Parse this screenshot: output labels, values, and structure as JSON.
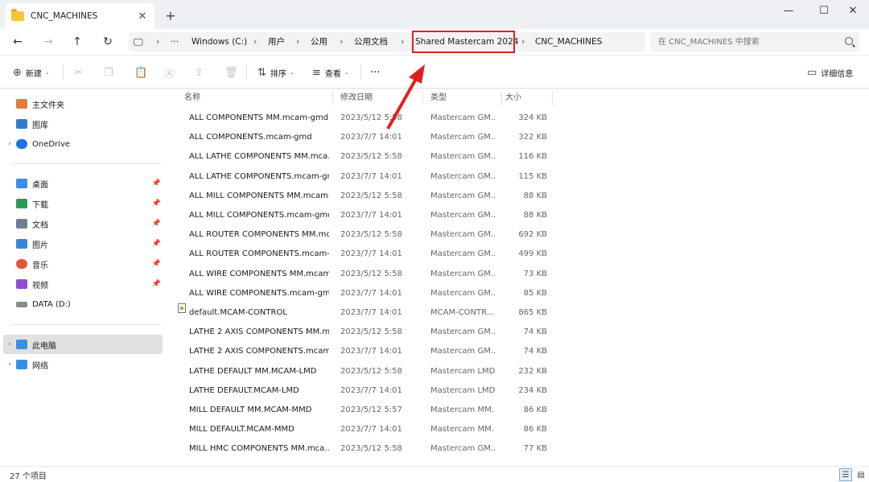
{
  "window": {
    "tab_title": "CNC_MACHINES",
    "tab_close": "✕",
    "new_tab": "+",
    "minimize": "—",
    "maximize": "☐",
    "close": "✕"
  },
  "address": {
    "more": "···",
    "breadcrumb": [
      "Windows (C:)",
      "用户",
      "公用",
      "公用文档",
      "Shared Mastercam 2024",
      "CNC_MACHINES"
    ],
    "highlighted": "Shared Mastercam 2024",
    "search_placeholder": "在 CNC_MACHINES 中搜索"
  },
  "toolbar": {
    "new_label": "新建",
    "sort_label": "排序",
    "view_label": "查看",
    "more_label": "···",
    "details_label": "详细信息"
  },
  "sidebar": {
    "top": [
      {
        "label": "主文件夹",
        "icon": "home-icon",
        "color": "#e37b3b"
      },
      {
        "label": "图库",
        "icon": "gallery-icon",
        "color": "#2f7dd1"
      },
      {
        "label": "OneDrive",
        "icon": "cloud-icon",
        "color": "#1a73e8"
      }
    ],
    "quick": [
      {
        "label": "桌面",
        "icon": "desktop-icon",
        "color": "#3a8ee6"
      },
      {
        "label": "下载",
        "icon": "download-icon",
        "color": "#2b9a59"
      },
      {
        "label": "文档",
        "icon": "document-icon",
        "color": "#6d7f95"
      },
      {
        "label": "图片",
        "icon": "picture-icon",
        "color": "#3b86d6"
      },
      {
        "label": "音乐",
        "icon": "music-icon",
        "color": "#e3573b"
      },
      {
        "label": "视频",
        "icon": "video-icon",
        "color": "#8e4fd0"
      },
      {
        "label": "DATA (D:)",
        "icon": "drive-icon",
        "color": "#8a8a8a"
      }
    ],
    "bottom": [
      {
        "label": "此电脑",
        "icon": "computer-icon",
        "color": "#3a8ee6"
      },
      {
        "label": "网络",
        "icon": "network-icon",
        "color": "#3a8ee6"
      }
    ]
  },
  "columns": {
    "name": "名称",
    "date": "修改日期",
    "type": "类型",
    "size": "大小"
  },
  "files": [
    {
      "name": "ALL COMPONENTS MM.mcam-gmd",
      "date": "2023/5/12 5:58",
      "type": "Mastercam GM...",
      "size": "324 KB"
    },
    {
      "name": "ALL COMPONENTS.mcam-gmd",
      "date": "2023/7/7 14:01",
      "type": "Mastercam GM...",
      "size": "322 KB"
    },
    {
      "name": "ALL LATHE COMPONENTS MM.mca...",
      "date": "2023/5/12 5:58",
      "type": "Mastercam GM...",
      "size": "116 KB"
    },
    {
      "name": "ALL LATHE COMPONENTS.mcam-gmd",
      "date": "2023/7/7 14:01",
      "type": "Mastercam GM...",
      "size": "115 KB"
    },
    {
      "name": "ALL MILL COMPONENTS MM.mcam-...",
      "date": "2023/5/12 5:58",
      "type": "Mastercam GM...",
      "size": "88 KB"
    },
    {
      "name": "ALL MILL COMPONENTS.mcam-gmd",
      "date": "2023/7/7 14:01",
      "type": "Mastercam GM...",
      "size": "88 KB"
    },
    {
      "name": "ALL ROUTER COMPONENTS MM.mc...",
      "date": "2023/5/12 5:58",
      "type": "Mastercam GM...",
      "size": "692 KB"
    },
    {
      "name": "ALL ROUTER COMPONENTS.mcam-g...",
      "date": "2023/7/7 14:01",
      "type": "Mastercam GM...",
      "size": "499 KB"
    },
    {
      "name": "ALL WIRE COMPONENTS MM.mcam...",
      "date": "2023/5/12 5:58",
      "type": "Mastercam GM...",
      "size": "73 KB"
    },
    {
      "name": "ALL WIRE COMPONENTS.mcam-gmd",
      "date": "2023/7/7 14:01",
      "type": "Mastercam GM...",
      "size": "85 KB"
    },
    {
      "name": "default.MCAM-CONTROL",
      "date": "2023/7/7 14:01",
      "type": "MCAM-CONTR...",
      "size": "865 KB"
    },
    {
      "name": "LATHE 2 AXIS COMPONENTS MM.m...",
      "date": "2023/5/12 5:58",
      "type": "Mastercam GM...",
      "size": "74 KB"
    },
    {
      "name": "LATHE 2 AXIS COMPONENTS.mcam-...",
      "date": "2023/7/7 14:01",
      "type": "Mastercam GM...",
      "size": "74 KB"
    },
    {
      "name": "LATHE DEFAULT MM.MCAM-LMD",
      "date": "2023/5/12 5:58",
      "type": "Mastercam LMD...",
      "size": "232 KB"
    },
    {
      "name": "LATHE DEFAULT.MCAM-LMD",
      "date": "2023/7/7 14:01",
      "type": "Mastercam LMD...",
      "size": "234 KB"
    },
    {
      "name": "MILL DEFAULT MM.MCAM-MMD",
      "date": "2023/5/12 5:57",
      "type": "Mastercam MM...",
      "size": "86 KB"
    },
    {
      "name": "MILL DEFAULT.MCAM-MMD",
      "date": "2023/7/7 14:01",
      "type": "Mastercam MM...",
      "size": "86 KB"
    },
    {
      "name": "MILL HMC COMPONENTS MM.mca...",
      "date": "2023/5/12 5:58",
      "type": "Mastercam GM...",
      "size": "77 KB"
    }
  ],
  "status": {
    "item_count": "27 个项目"
  },
  "colors": {
    "accent_highlight": "#e02020",
    "selected_nav": "#e1e1e1",
    "folder": "#f5c542"
  }
}
